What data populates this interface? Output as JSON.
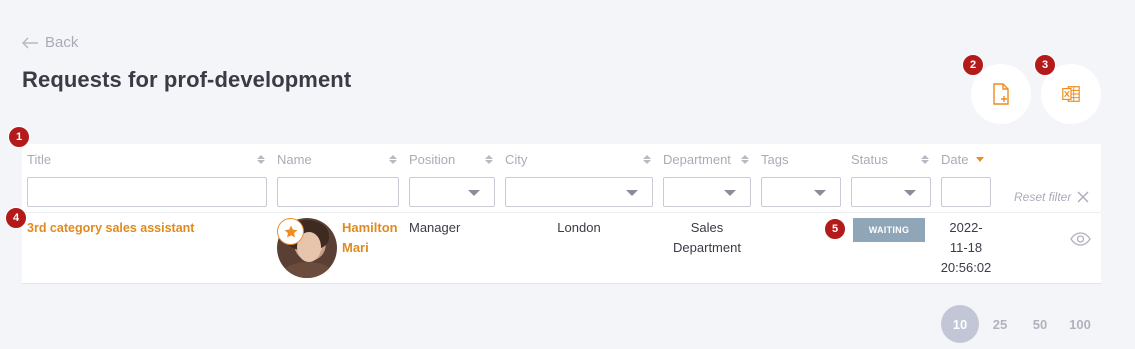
{
  "nav": {
    "back_label": "Back"
  },
  "page": {
    "title": "Requests for prof-development"
  },
  "markers": [
    "1",
    "2",
    "3",
    "4",
    "5"
  ],
  "table": {
    "columns": [
      "Title",
      "Name",
      "Position",
      "City",
      "Department",
      "Tags",
      "Status",
      "Date"
    ],
    "reset_filter_label": "Reset filter",
    "rows": [
      {
        "title": "3rd category sales assistant",
        "name_first": "Hamilton",
        "name_last": "Mari",
        "position": "Manager",
        "city": "London",
        "department_line1": "Sales",
        "department_line2": "Department",
        "status": "WAITING",
        "date_line1": "2022-",
        "date_line2": "11-18",
        "date_line3": "20:56:02"
      }
    ]
  },
  "pagination": {
    "sizes": [
      "10",
      "25",
      "50",
      "100"
    ],
    "active": "10"
  },
  "colors": {
    "accent": "#f08b1d",
    "marker": "#b31b1b",
    "status_waiting": "#8fa6b8"
  },
  "icons": [
    "arrow-left-icon",
    "add-file-icon",
    "excel-icon",
    "sort-icon",
    "sort-desc-icon",
    "chevron-down-icon",
    "close-icon",
    "star-icon",
    "eye-icon"
  ]
}
